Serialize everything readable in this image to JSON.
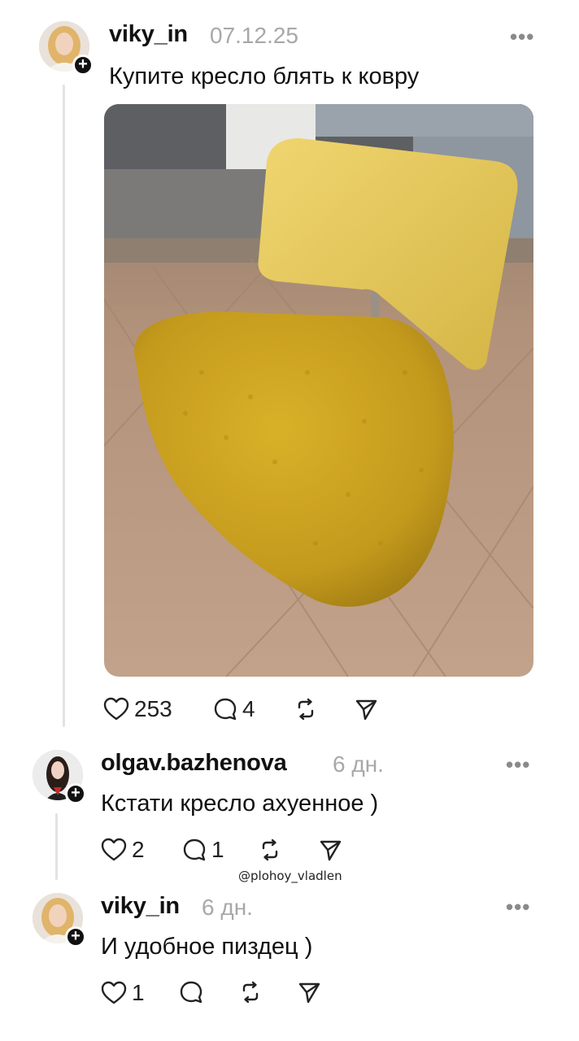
{
  "post": {
    "username": "viky_in",
    "time": "07.12.25",
    "text": "Купите кресло блять к ковру",
    "likes": "253",
    "comments": "4"
  },
  "reply1": {
    "username": "olgav.bazhenova",
    "time": "6 дн.",
    "text": "Кстати кресло ахуенное )",
    "likes": "2",
    "comments": "1"
  },
  "reply2": {
    "username": "viky_in",
    "time": "6 дн.",
    "text": "И удобное пиздец )",
    "likes": "1"
  },
  "watermark": "@plohoy_vladlen",
  "colors": {
    "seat": "#c9a21f",
    "backrest": "#e6c85a",
    "floor": "#b39273"
  }
}
